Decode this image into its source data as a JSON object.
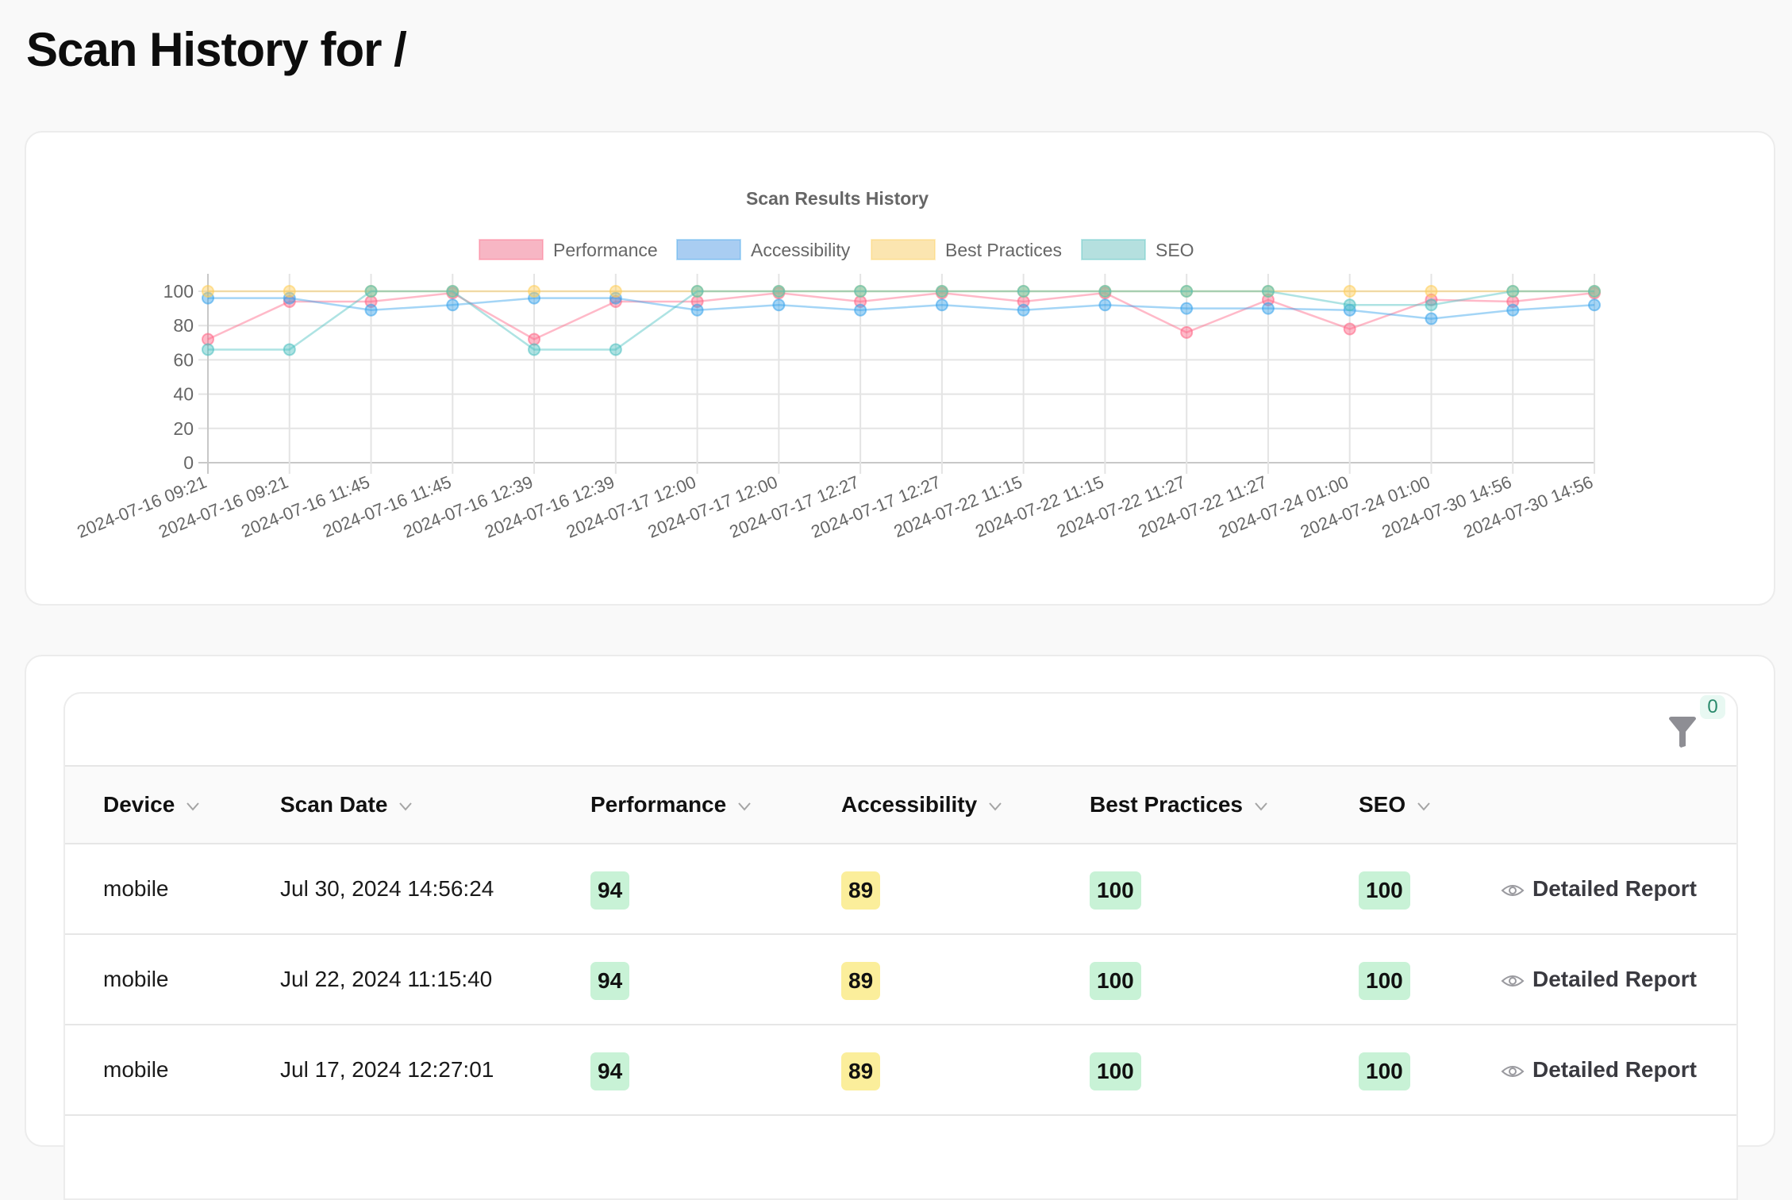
{
  "page": {
    "title": "Scan History for /"
  },
  "chart_data": {
    "type": "line",
    "title": "Scan Results History",
    "xlabel": "",
    "ylabel": "",
    "ylim": [
      0,
      100
    ],
    "yticks": [
      0,
      20,
      40,
      60,
      80,
      100
    ],
    "grid": true,
    "legend_position": "top-center",
    "x": [
      "2024-07-16 09:21",
      "2024-07-16 09:21",
      "2024-07-16 11:45",
      "2024-07-16 11:45",
      "2024-07-16 12:39",
      "2024-07-16 12:39",
      "2024-07-17 12:00",
      "2024-07-17 12:00",
      "2024-07-17 12:27",
      "2024-07-17 12:27",
      "2024-07-22 11:15",
      "2024-07-22 11:15",
      "2024-07-22 11:27",
      "2024-07-22 11:27",
      "2024-07-24 01:00",
      "2024-07-24 01:00",
      "2024-07-30 14:56",
      "2024-07-30 14:56"
    ],
    "series": [
      {
        "name": "Performance",
        "color": "#ff6384",
        "fill": "#f7b6c4",
        "values": [
          72,
          94,
          94,
          99,
          72,
          94,
          94,
          99,
          94,
          99,
          94,
          99,
          76,
          95,
          78,
          95,
          94,
          99
        ]
      },
      {
        "name": "Accessibility",
        "color": "#36a2eb",
        "fill": "#a9cdf2",
        "values": [
          96,
          96,
          89,
          92,
          96,
          96,
          89,
          92,
          89,
          92,
          89,
          92,
          90,
          90,
          89,
          84,
          89,
          92
        ]
      },
      {
        "name": "Best Practices",
        "color": "#ffcd56",
        "fill": "#fbe5b0",
        "values": [
          100,
          100,
          100,
          100,
          100,
          100,
          100,
          100,
          100,
          100,
          100,
          100,
          100,
          100,
          100,
          100,
          100,
          100
        ]
      },
      {
        "name": "SEO",
        "color": "#4bc0c0",
        "fill": "#b5e0df",
        "values": [
          66,
          66,
          100,
          100,
          66,
          66,
          100,
          100,
          100,
          100,
          100,
          100,
          100,
          100,
          92,
          92,
          100,
          100
        ]
      }
    ]
  },
  "table": {
    "filter_count": "0",
    "columns": [
      {
        "key": "device",
        "label": "Device"
      },
      {
        "key": "scan_date",
        "label": "Scan Date"
      },
      {
        "key": "performance",
        "label": "Performance"
      },
      {
        "key": "accessibility",
        "label": "Accessibility"
      },
      {
        "key": "best_practices",
        "label": "Best Practices"
      },
      {
        "key": "seo",
        "label": "SEO"
      }
    ],
    "action_label": "Detailed Report",
    "colors": {
      "good": "#c8f2d6",
      "average": "#fbee9b"
    },
    "rows": [
      {
        "device": "mobile",
        "scan_date": "Jul 30, 2024 14:56:24",
        "performance": "94",
        "accessibility": "89",
        "best_practices": "100",
        "seo": "100"
      },
      {
        "device": "mobile",
        "scan_date": "Jul 22, 2024 11:15:40",
        "performance": "94",
        "accessibility": "89",
        "best_practices": "100",
        "seo": "100"
      },
      {
        "device": "mobile",
        "scan_date": "Jul 17, 2024 12:27:01",
        "performance": "94",
        "accessibility": "89",
        "best_practices": "100",
        "seo": "100"
      }
    ]
  }
}
